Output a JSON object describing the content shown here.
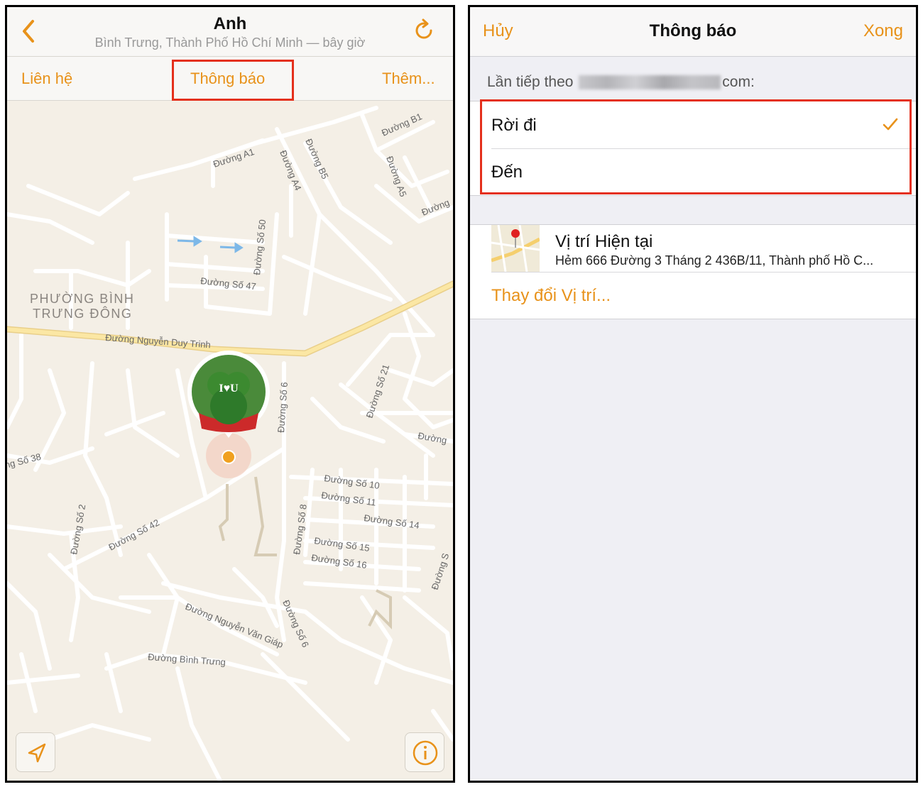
{
  "left": {
    "header": {
      "title": "Anh",
      "subtitle": "Bình Trưng, Thành Phố Hồ Chí Minh — bây giờ"
    },
    "tabs": [
      {
        "label": "Liên hệ"
      },
      {
        "label": "Thông báo"
      },
      {
        "label": "Thêm..."
      }
    ],
    "map": {
      "district_line1": "PHƯỜNG BÌNH",
      "district_line2": "TRƯNG ĐÔNG",
      "streets": {
        "nguyen_duy_trinh": "Đường Nguyễn Duy Trinh",
        "a1": "Đường A1",
        "a4": "Đường A4",
        "b5": "Đường B5",
        "b1": "Đường B1",
        "a5": "Đường A5",
        "duong_right": "Đường",
        "so50": "Đường Số 50",
        "so47": "Đường Số 47",
        "so6_top": "Đường Số 6",
        "so21": "Đường Số 21",
        "so38": "ng Số 38",
        "so2": "Đường Số 2",
        "so42": "Đường Số 42",
        "so8": "Đường Số 8",
        "so10": "Đường Số 10",
        "so11": "Đường Số 11",
        "so14": "Đường Số 14",
        "so15": "Đường Số 15",
        "so16": "Đường Số 16",
        "duong_mid": "Đường",
        "duong_s": "Đường S",
        "nguyen_van_giap": "Đường Nguyễn Văn Giáp",
        "so6_bottom": "Đường Số 6",
        "binh_trung": "Đường Bình Trưng"
      },
      "avatar_text": "I♥U"
    }
  },
  "right": {
    "header": {
      "cancel": "Hủy",
      "title": "Thông báo",
      "done": "Xong"
    },
    "section_prefix": "Lần tiếp theo",
    "section_suffix": "com:",
    "options": [
      {
        "label": "Rời đi",
        "selected": true
      },
      {
        "label": "Đến",
        "selected": false
      }
    ],
    "location": {
      "title": "Vị trí Hiện tại",
      "address": "Hẻm 666 Đường 3 Tháng 2 436B/11, Thành phố Hồ C...",
      "change": "Thay đổi Vị trí..."
    }
  },
  "colors": {
    "accent": "#e8921a",
    "highlight_box": "#e4301c",
    "map_bg": "#f4efe6",
    "road": "#ffffff",
    "main_road": "#f5d070"
  }
}
